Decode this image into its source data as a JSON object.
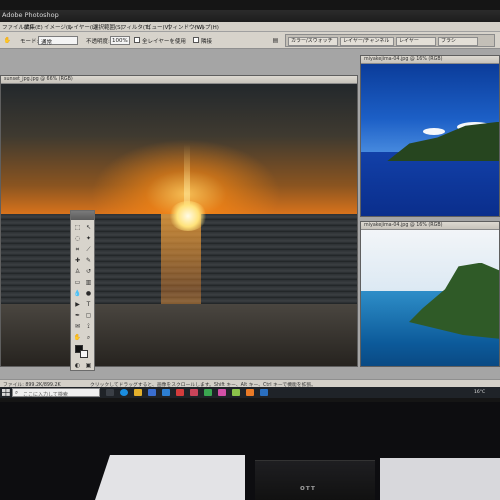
{
  "app": {
    "title": "Adobe Photoshop",
    "menu": [
      "ファイル(F)",
      "編集(E)",
      "イメージ(I)",
      "レイヤー(L)",
      "選択範囲(S)",
      "フィルタ(T)",
      "ビュー(V)",
      "ウィンドウ(W)",
      "ヘルプ(H)"
    ]
  },
  "options_bar": {
    "mode_label": "モード:",
    "mode_value": "通常",
    "opacity_label": "不透明度:",
    "opacity_value": "100%",
    "all_layers_label": "全レイヤーを使用",
    "contiguous_label": "隣接",
    "palette_well_tabs": [
      "カラー/スウォッチ",
      "レイヤー/チャンネル",
      "レイヤー",
      "ブラシ"
    ]
  },
  "documents": {
    "sunset": {
      "title": "sunset_jpg.jpg @ 66% (RGB)"
    },
    "ocean_top": {
      "title": "miyakejima-04.jpg @ 16% (RGB)"
    },
    "ocean_bottom": {
      "title": "miyakejima-04.jpg @ 16% (RGB)"
    }
  },
  "status_bar": {
    "doc_info": "ファイル: 899.2K/899.2K",
    "hint": "クリックしてドラッグすると、画像をスクロールします。Shift キー、Alt キー、Ctrl キーで機能を拡張。"
  },
  "taskbar": {
    "search_placeholder": "ここに入力して検索",
    "tray_temp": "16°C",
    "apps": [
      {
        "name": "task-view",
        "color": "#3a3f46"
      },
      {
        "name": "edge",
        "color": "#1a8de0"
      },
      {
        "name": "explorer",
        "color": "#e3b02c"
      },
      {
        "name": "store",
        "color": "#3a6ed0"
      },
      {
        "name": "mail",
        "color": "#2d7fd3"
      },
      {
        "name": "app-red",
        "color": "#d33c3c"
      },
      {
        "name": "app-cat",
        "color": "#c8445a"
      },
      {
        "name": "app-green",
        "color": "#3aa650"
      },
      {
        "name": "app-pink",
        "color": "#d24fa6"
      },
      {
        "name": "app-lime",
        "color": "#8bc34a"
      },
      {
        "name": "app-orange",
        "color": "#e97a27"
      },
      {
        "name": "app-blue2",
        "color": "#2a6fc0"
      }
    ]
  },
  "hardware": {
    "logo": "ᴏᴛᴛ"
  },
  "colors": {
    "accent_ps": "#1c5fc6",
    "foreground_swatch": "#111111",
    "background_swatch": "#f5f5f5"
  }
}
